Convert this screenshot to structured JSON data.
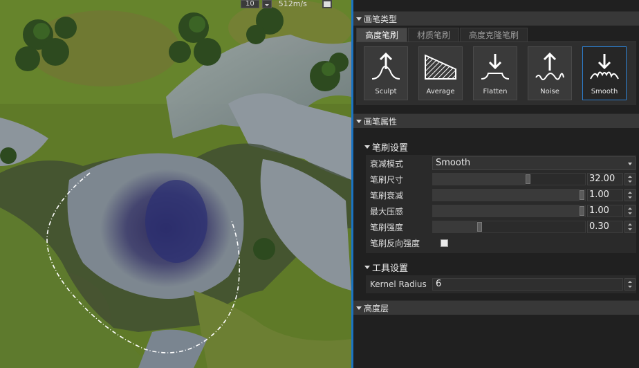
{
  "viewport": {
    "number_value": "10",
    "speed": "512m/s",
    "dash_ring": "white"
  },
  "panel": {
    "brush_type": {
      "title": "画笔类型",
      "tabs": [
        "高度笔刷",
        "材质笔刷",
        "高度克隆笔刷"
      ],
      "active_tab": "高度笔刷",
      "brushes": [
        {
          "label": "Sculpt",
          "icon": "sculpt-brush-icon"
        },
        {
          "label": "Average",
          "icon": "average-brush-icon"
        },
        {
          "label": "Flatten",
          "icon": "flatten-brush-icon"
        },
        {
          "label": "Noise",
          "icon": "noise-brush-icon"
        },
        {
          "label": "Smooth",
          "icon": "smooth-brush-icon"
        }
      ],
      "selected": "Smooth"
    },
    "brush_props": {
      "title": "画笔属性",
      "brush_settings": {
        "title": "笔刷设置",
        "falloff_label": "衰减模式",
        "falloff_value": "Smooth",
        "size_label": "笔刷尺寸",
        "size_value": "32.00",
        "size_fraction": 0.63,
        "decay_label": "笔刷衰减",
        "decay_value": "1.00",
        "decay_fraction": 1.0,
        "pressure_label": "最大压感",
        "pressure_value": "1.00",
        "pressure_fraction": 1.0,
        "strength_label": "笔刷强度",
        "strength_value": "0.30",
        "strength_fraction": 0.3,
        "invert_label": "笔刷反向强度",
        "invert_checked": false
      },
      "tool_settings": {
        "title": "工具设置",
        "kernel_label": "Kernel Radius",
        "kernel_value": "6"
      }
    },
    "height_layer": {
      "title": "高度层"
    },
    "accent": "#2d7fd0"
  }
}
